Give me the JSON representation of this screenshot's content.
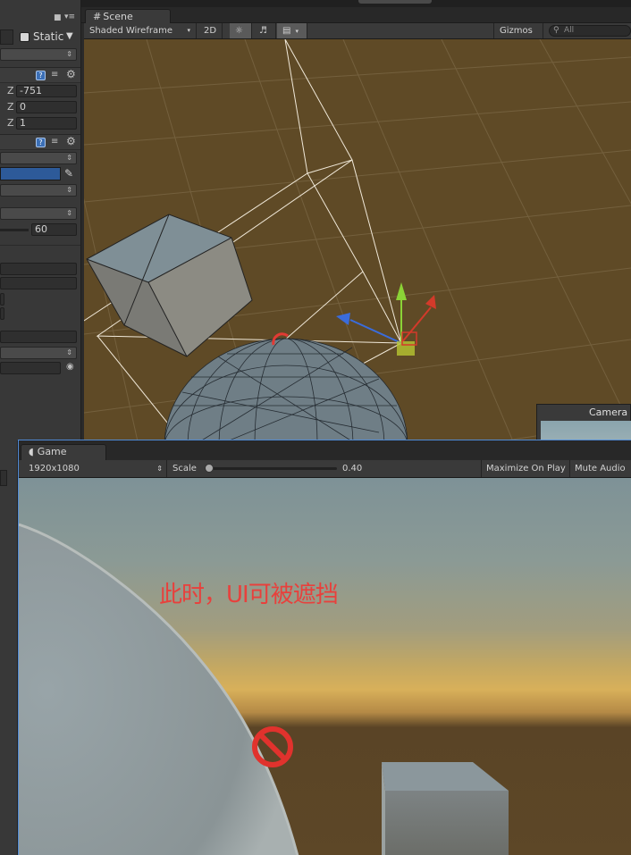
{
  "inspector": {
    "static_label": "Static",
    "position_z_label": "Z",
    "position_z_value": "-751",
    "rotation_z_label": "Z",
    "rotation_z_value": "0",
    "scale_z_label": "Z",
    "scale_z_value": "1",
    "fov_value": "60",
    "help_glyph": "?"
  },
  "scene": {
    "tab_label": "Scene",
    "render_mode": "Shaded Wireframe",
    "btn_2d": "2D",
    "gizmos_label": "Gizmos",
    "search_placeholder": "All"
  },
  "camera_preview": {
    "title": "Camera"
  },
  "game": {
    "tab_label": "Game",
    "resolution": "1920x1080",
    "scale_label": "Scale",
    "scale_value": "0.40",
    "scale_fraction": 0.0,
    "maximize_label": "Maximize On Play",
    "mute_label": "Mute Audio",
    "overlay_text": "此时，UI可被遮挡"
  },
  "colors": {
    "scene_bg": "#5f4a26",
    "selection_border": "#4f8ad6",
    "overlay_text": "#e8403c"
  }
}
